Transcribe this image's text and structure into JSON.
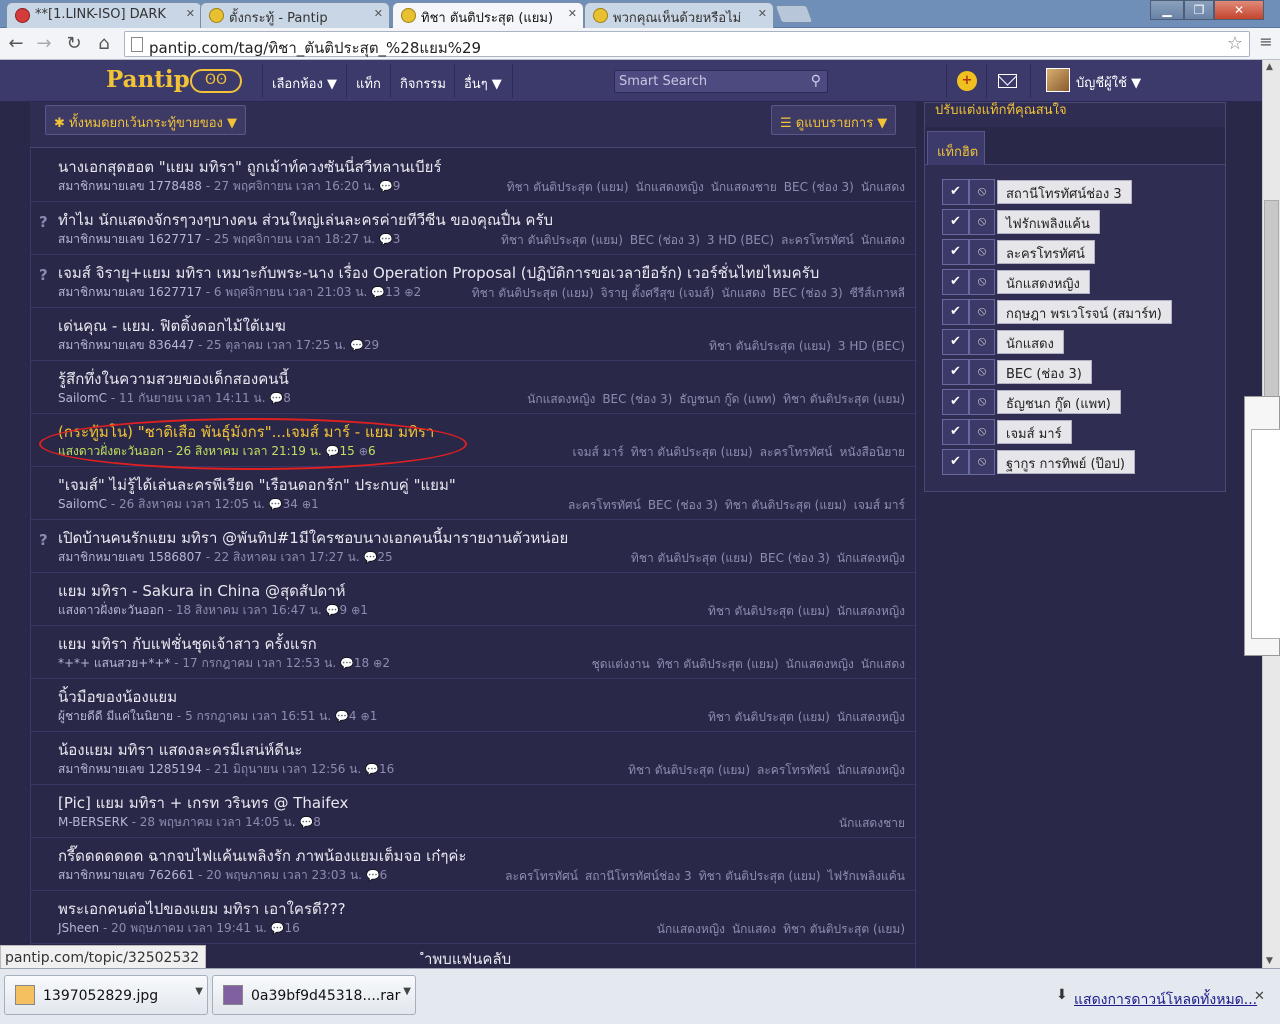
{
  "browser": {
    "tabs": [
      {
        "title": "**[1.LINK-ISO] DARK",
        "icon": "red"
      },
      {
        "title": "ตั้งกระทู้ - Pantip",
        "icon": "pantip"
      },
      {
        "title": "ทิชา ตันติประสุต (แยม)",
        "icon": "pantip"
      },
      {
        "title": "พวกคุณเห็นด้วยหรือไม่",
        "icon": "pantip"
      }
    ],
    "url": "pantip.com/tag/ทิชา_ตันติประสุต_%28แยม%29",
    "status_url": "pantip.com/topic/32502532"
  },
  "site": {
    "logo": "Pantip",
    "logo_mark": "ʘʘ",
    "nav": [
      "เลือกห้อง ▼",
      "แท็ก",
      "กิจกรรม",
      "อื่นๆ ▼"
    ],
    "search_placeholder": "Smart Search",
    "account": "บัญชีผู้ใช้ ▼"
  },
  "filters": {
    "all_label": "ทั้งหมดยกเว้นกระทู้ขายของ ▼",
    "view_label": "ดูแบบรายการ ▼"
  },
  "topics": [
    {
      "q": false,
      "title": "นางเอกสุดฮอต \"แยม มทิรา\" ถูกเม้าท์ควงซันนี่สวีทลานเบียร์",
      "author": "สมาชิกหมายเลข 1778488",
      "date": "27 พฤศจิกายน เวลา 16:20 น.",
      "comments": "9",
      "votes": "",
      "tags": [
        "ทิชา ตันติประสุต (แยม)",
        "นักแสดงหญิง",
        "นักแสดงชาย",
        "BEC (ช่อง 3)",
        "นักแสดง"
      ]
    },
    {
      "q": true,
      "title": "ทำไม นักแสดงจักรๆวงๆบางคน ส่วนใหญ่เล่นละครค่ายทีวีซีน ของคุณปื่น ครับ",
      "author": "สมาชิกหมายเลข 1627717",
      "date": "25 พฤศจิกายน เวลา 18:27 น.",
      "comments": "3",
      "votes": "",
      "tags": [
        "ทิชา ตันติประสุต (แยม)",
        "BEC (ช่อง 3)",
        "3 HD (BEC)",
        "ละครโทรทัศน์",
        "นักแสดง"
      ]
    },
    {
      "q": true,
      "title": "เจมส์ จิรายุ+แยม มทิรา เหมาะกับพระ-นาง เรื่อง Operation Proposal (ปฏิบัติการขอเวลายือรัก) เวอร์ชั่นไทยไหมครับ",
      "author": "สมาชิกหมายเลข 1627717",
      "date": "6 พฤศจิกายน เวลา 21:03 น.",
      "comments": "13",
      "votes": "2",
      "tags": [
        "ทิชา ตันติประสุต (แยม)",
        "จิรายุ ตั้งศรีสุข (เจมส์)",
        "นักแสดง",
        "BEC (ช่อง 3)",
        "ซีรีส์เกาหลี"
      ]
    },
    {
      "q": false,
      "title": "เด่นคุณ - แยม. ฟิตติ้งดอกไม้ใต้เมฆ",
      "author": "สมาชิกหมายเลข 836447",
      "date": "25 ตุลาคม เวลา 17:25 น.",
      "comments": "29",
      "votes": "",
      "tags": [
        "ทิชา ตันติประสุต (แยม)",
        "3 HD (BEC)"
      ]
    },
    {
      "q": false,
      "title": "รู้สึกทึ่งในความสวยของเด็กสองคนนี้",
      "author": "SailomC",
      "date": "11 กันยายน เวลา 14:11 น.",
      "comments": "8",
      "votes": "",
      "tags": [
        "นักแสดงหญิง",
        "BEC (ช่อง 3)",
        "ธัญชนก กู๊ด (แพท)",
        "ทิชา ตันติประสุต (แยม)"
      ]
    },
    {
      "q": false,
      "hl": true,
      "title": "(กระทู้มโน) \"ชาติเสือ พันธุ์มังกร\"...เจมส์ มาร์ - แยม มทิรา",
      "author": "แสงดาวฝั่งตะวันออก",
      "date": "26 สิงหาคม เวลา 21:19 น.",
      "comments": "15",
      "votes": "6",
      "tags": [
        "เจมส์ มาร์",
        "ทิชา ตันติประสุต (แยม)",
        "ละครโทรทัศน์",
        "หนังสือนิยาย"
      ]
    },
    {
      "q": false,
      "title": "\"เจมส์\" ไม่รู้ได้เล่นละครพีเรียด \"เรือนดอกรัก\" ประกบคู่ \"แยม\"",
      "author": "SailomC",
      "date": "26 สิงหาคม เวลา 12:05 น.",
      "comments": "34",
      "votes": "1",
      "tags": [
        "ละครโทรทัศน์",
        "BEC (ช่อง 3)",
        "ทิชา ตันติประสุต (แยม)",
        "เจมส์ มาร์"
      ]
    },
    {
      "q": true,
      "title": "เปิดบ้านคนรักแยม มทิรา @พันทิป#1มีใครชอบนางเอกคนนี้มารายงานตัวหน่อย",
      "author": "สมาชิกหมายเลข 1586807",
      "date": "22 สิงหาคม เวลา 17:27 น.",
      "comments": "25",
      "votes": "",
      "tags": [
        "ทิชา ตันติประสุต (แยม)",
        "BEC (ช่อง 3)",
        "นักแสดงหญิง"
      ]
    },
    {
      "q": false,
      "title": "แยม มทิรา - Sakura in China @สุดสัปดาห์",
      "author": "แสงดาวฝั่งตะวันออก",
      "date": "18 สิงหาคม เวลา 16:47 น.",
      "comments": "9",
      "votes": "1",
      "tags": [
        "ทิชา ตันติประสุต (แยม)",
        "นักแสดงหญิง"
      ]
    },
    {
      "q": false,
      "title": "แยม มทิรา กับแฟชั่นชุดเจ้าสาว ครั้งแรก",
      "author": "*+*+ แสนสวย+*+*",
      "date": "17 กรกฎาคม เวลา 12:53 น.",
      "comments": "18",
      "votes": "2",
      "tags": [
        "ชุดแต่งงาน",
        "ทิชา ตันติประสุต (แยม)",
        "นักแสดงหญิง",
        "นักแสดง"
      ]
    },
    {
      "q": false,
      "title": "นิ้วมือของน้องแยม",
      "author": "ผู้ชายดีดี มีแค่ในนิยาย",
      "date": "5 กรกฎาคม เวลา 16:51 น.",
      "comments": "4",
      "votes": "1",
      "tags": [
        "ทิชา ตันติประสุต (แยม)",
        "นักแสดงหญิง"
      ]
    },
    {
      "q": false,
      "title": "น้องแยม มทิรา แสดงละครมีเสน่ห์ดีนะ",
      "author": "สมาชิกหมายเลข 1285194",
      "date": "21 มิถุนายน เวลา 12:56 น.",
      "comments": "16",
      "votes": "",
      "tags": [
        "ทิชา ตันติประสุต (แยม)",
        "ละครโทรทัศน์",
        "นักแสดงหญิง"
      ]
    },
    {
      "q": false,
      "title": "[Pic] แยม มทิรา + เกรท วรินทร @ Thaifex",
      "author": "M-BERSERK",
      "date": "28 พฤษภาคม เวลา 14:05 น.",
      "comments": "8",
      "votes": "",
      "tags": [
        "นักแสดงชาย"
      ]
    },
    {
      "q": false,
      "title": "กรี๊ดดดดดดด ฉากจบไฟแค้นเพลิงรัก ภาพน้องแยมเต็มจอ เก๋ๆค่ะ",
      "author": "สมาชิกหมายเลข 762661",
      "date": "20 พฤษภาคม เวลา 23:03 น.",
      "comments": "6",
      "votes": "",
      "tags": [
        "ละครโทรทัศน์",
        "สถานีโทรทัศน์ช่อง 3",
        "ทิชา ตันติประสุต (แยม)",
        "ไฟรักเพลิงแค้น"
      ]
    },
    {
      "q": false,
      "title": "พระเอกคนต่อไปของแยม มทิรา เอาใครดี???",
      "author": "JSheen",
      "date": "20 พฤษภาคม เวลา 19:41 น.",
      "comments": "16",
      "votes": "",
      "tags": [
        "นักแสดงหญิง",
        "นักแสดง",
        "ทิชา ตันติประสุต (แยม)"
      ]
    }
  ],
  "partial_row_text": "ำพบแฟนคลับ",
  "right_panel": {
    "heading": "ปรับแต่งแท็กที่คุณสนใจ",
    "tab": "แท็กฮิต",
    "tags": [
      "สถานีโทรทัศน์ช่อง 3",
      "ไฟรักเพลิงแค้น",
      "ละครโทรทัศน์",
      "นักแสดงหญิง",
      "กฤษฎา พรเวโรจน์ (สมาร์ท)",
      "นักแสดง",
      "BEC (ช่อง 3)",
      "ธัญชนก กู๊ด (แพท)",
      "เจมส์ มาร์",
      "ฐากูร การทิพย์ (ป๊อป)"
    ]
  },
  "downloads": {
    "items": [
      "1397052829.jpg",
      "0a39bf9d45318....rar"
    ],
    "show_all": "แสดงการดาวน์โหลดทั้งหมด..."
  }
}
